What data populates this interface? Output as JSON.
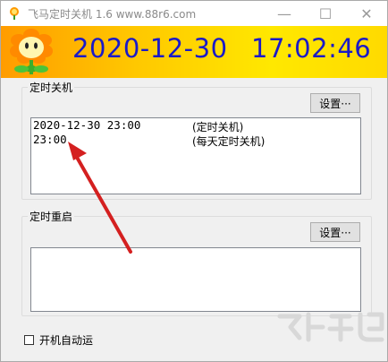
{
  "window": {
    "title": "飞马定时关机 1.6  www.88r6.com",
    "minimize_glyph": "—",
    "maximize_glyph": "☐",
    "close_glyph": "✕"
  },
  "banner": {
    "date": "2020-12-30",
    "time": "17:02:46",
    "gradient_colors": [
      "#ff9c00",
      "#ffe800"
    ],
    "clock_color": "#1a1ac8"
  },
  "shutdown_group": {
    "label": "定时关机",
    "settings_button": "设置···",
    "entries": [
      {
        "time": "2020-12-30 23:00",
        "desc": "(定时关机)"
      },
      {
        "time": "23:00",
        "desc": "(每天定时关机)"
      }
    ]
  },
  "restart_group": {
    "label": "定时重启",
    "settings_button": "设置···",
    "entries": []
  },
  "autostart": {
    "label": "开机自动运",
    "checked": false
  },
  "annotation": {
    "arrow_color": "#d42020"
  },
  "icons": {
    "app": "flower-icon",
    "banner": "flower-icon"
  }
}
